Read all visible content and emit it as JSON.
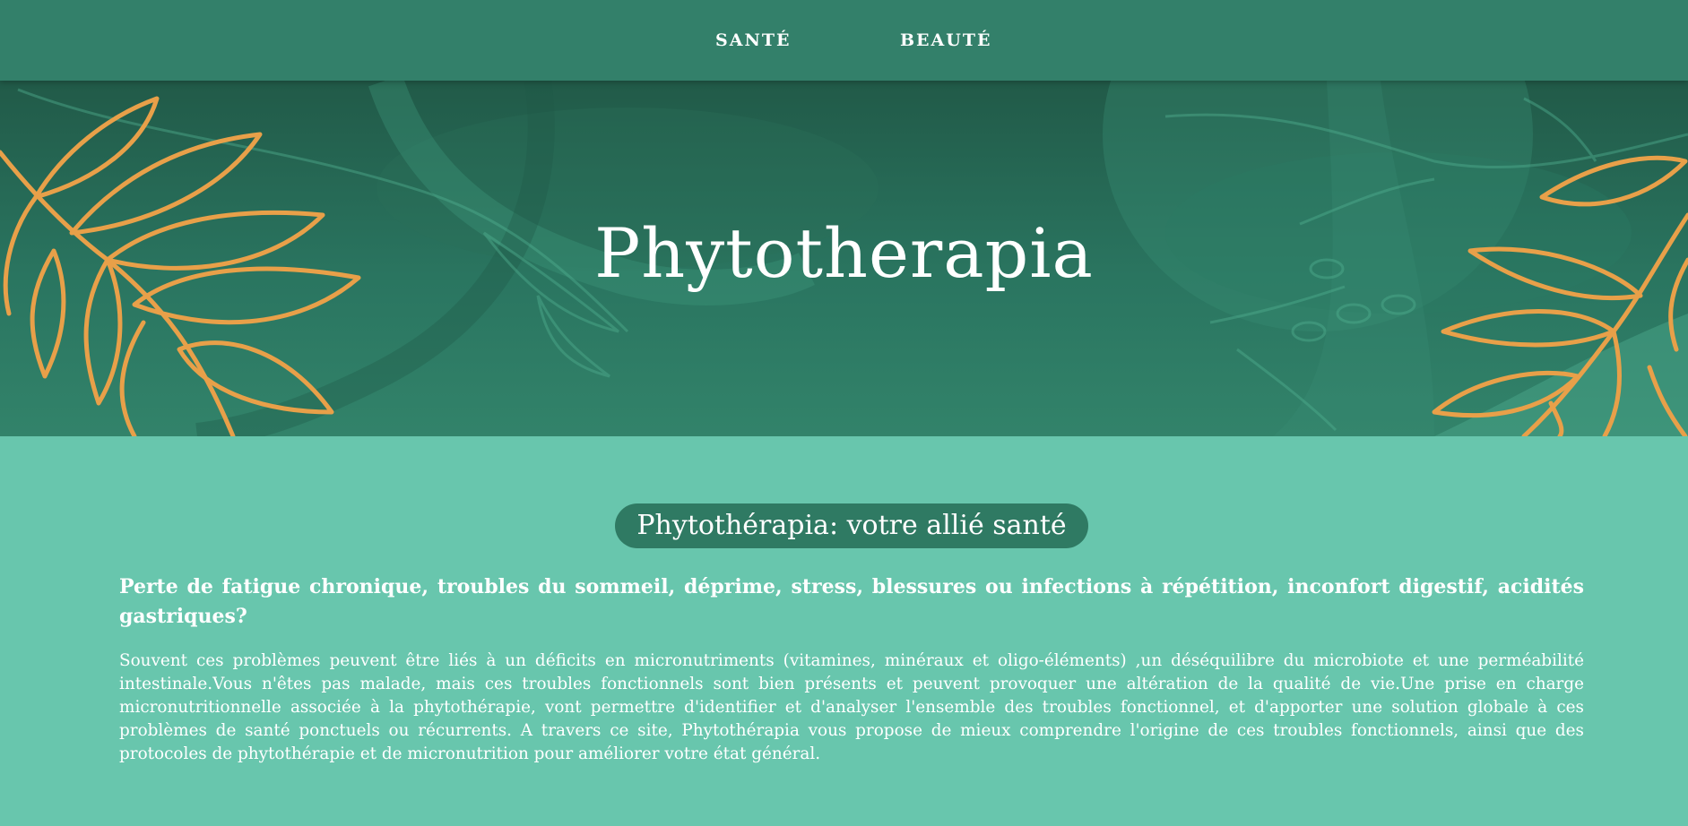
{
  "nav": {
    "items": [
      {
        "label": "SANTÉ"
      },
      {
        "label": "BEAUTÉ"
      }
    ]
  },
  "hero": {
    "title": "Phytotherapia"
  },
  "main": {
    "pill": "Phytothérapia: votre allié santé",
    "lead": "Perte de fatigue chronique, troubles du sommeil, déprime, stress, blessures ou infections à répétition, inconfort digestif, acidités gastriques?",
    "body": "Souvent ces problèmes peuvent être liés à un déficits en micronutriments (vitamines, minéraux et oligo-éléments) ,un déséquilibre du microbiote et une perméabilité intestinale.Vous n'êtes pas malade, mais ces troubles fonctionnels sont bien présents et peuvent provoquer une altération de la qualité de vie.Une prise en charge micronutritionnelle associée à la phytothérapie, vont permettre d'identifier et d'analyser l'ensemble des troubles fonctionnel, et d'apporter une solution globale à ces problèmes de santé ponctuels ou récurrents. A travers ce site, Phytothérapia vous propose de mieux comprendre l'origine de ces troubles fonctionnels, ainsi que des protocoles de phytothérapie et de micronutrition pour améliorer votre état général."
  },
  "colors": {
    "navbar": "#33806a",
    "hero_dark": "#215a48",
    "content_bg": "#68c6ad",
    "pill_bg": "#2f7a63",
    "leaf_orange": "#e8a049",
    "text": "#ffffff"
  }
}
